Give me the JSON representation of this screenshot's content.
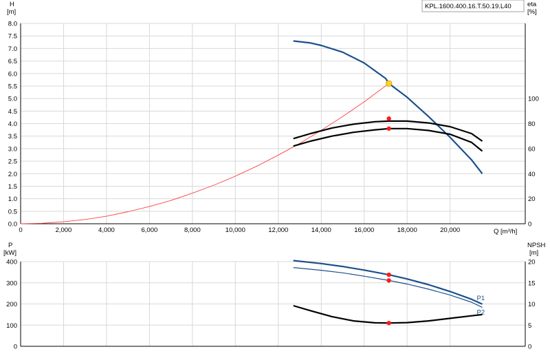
{
  "pump_id": "KPL.1600.400.16.T.50.19.L40",
  "top_axes": {
    "y_left_label": "H",
    "y_left_unit": "[m]",
    "y_right_label": "eta",
    "y_right_unit": "[%]",
    "x_label": "Q [m³/h]",
    "x_ticks": [
      "0",
      "2,000",
      "4,000",
      "6,000",
      "8,000",
      "10,000",
      "12,000",
      "14,000",
      "16,000",
      "18,000",
      "20,000"
    ],
    "y_left_ticks": [
      "0.0",
      "0.5",
      "1.0",
      "1.5",
      "2.0",
      "2.5",
      "3.0",
      "3.5",
      "4.0",
      "4.5",
      "5.0",
      "5.5",
      "6.0",
      "6.5",
      "7.0",
      "7.5",
      "8.0"
    ],
    "y_right_ticks": [
      "0",
      "20",
      "40",
      "60",
      "80",
      "100"
    ]
  },
  "bottom_axes": {
    "y_left_label": "P",
    "y_left_unit": "[kW]",
    "y_right_label": "NPSH",
    "y_right_unit": "[m]",
    "y_left_ticks": [
      "0",
      "100",
      "200",
      "300",
      "400"
    ],
    "y_right_ticks": [
      "0",
      "5",
      "10",
      "15",
      "20"
    ]
  },
  "chart_data": [
    {
      "type": "line",
      "panel": "head-efficiency",
      "xlabel": "Q [m³/h]",
      "ylabel": "H [m]",
      "y2label": "eta [%]",
      "xlim": [
        0,
        23500
      ],
      "ylim": [
        0,
        8.0
      ],
      "y2lim": [
        0,
        160
      ],
      "grid": true,
      "series": [
        {
          "name": "",
          "axis": "left",
          "color": "#1a4f8c",
          "x": [
            12700,
            13500,
            14000,
            15000,
            16000,
            17000,
            17150,
            18000,
            19000,
            20000,
            21000,
            21500
          ],
          "y": [
            7.3,
            7.22,
            7.12,
            6.85,
            6.42,
            5.8,
            5.6,
            5.05,
            4.28,
            3.45,
            2.55,
            2.0
          ]
        },
        {
          "name": "",
          "axis": "left",
          "color": "#ff4040",
          "x": [
            0,
            1000,
            2000,
            3000,
            4000,
            5000,
            6000,
            7000,
            8000,
            9000,
            10000,
            11000,
            12000,
            13000,
            14000,
            15000,
            16000,
            17150
          ],
          "y": [
            0,
            0.02,
            0.08,
            0.17,
            0.3,
            0.48,
            0.69,
            0.93,
            1.22,
            1.54,
            1.9,
            2.3,
            2.74,
            3.21,
            3.73,
            4.28,
            4.87,
            5.6
          ]
        },
        {
          "name": "",
          "axis": "right",
          "color": "#000000",
          "x": [
            12700,
            13500,
            14500,
            15500,
            16500,
            17150,
            18000,
            19000,
            20000,
            21000,
            21500
          ],
          "y": [
            68,
            72,
            76.5,
            79.5,
            81.5,
            82.0,
            82.0,
            80.5,
            77.5,
            72.0,
            66.0
          ]
        },
        {
          "name": "",
          "axis": "right",
          "color": "#000000",
          "x": [
            12700,
            13500,
            14500,
            15500,
            16500,
            17150,
            18000,
            19000,
            20000,
            21000,
            21500
          ],
          "y": [
            62,
            66,
            70,
            73,
            75,
            76.0,
            76.0,
            74.5,
            71.5,
            65.0,
            58.0
          ]
        }
      ],
      "markers": [
        {
          "series_axis": "left",
          "x": 17150,
          "y": 5.6,
          "color": "#ffd21e"
        },
        {
          "series_axis": "right",
          "x": 17150,
          "y": 84.0,
          "color": "#ff1a1a"
        },
        {
          "series_axis": "right",
          "x": 17150,
          "y": 76.0,
          "color": "#ff1a1a"
        }
      ]
    },
    {
      "type": "line",
      "panel": "power-npsh",
      "xlabel": "Q [m³/h]",
      "ylabel": "P [kW]",
      "y2label": "NPSH [m]",
      "xlim": [
        0,
        23500
      ],
      "ylim": [
        0,
        400
      ],
      "y2lim": [
        0,
        20
      ],
      "grid": true,
      "series": [
        {
          "name": "P1",
          "axis": "left",
          "color": "#1a4f8c",
          "x": [
            12700,
            14000,
            15000,
            16000,
            17150,
            18000,
            19000,
            20000,
            21000,
            21500
          ],
          "y": [
            405,
            391,
            377,
            360,
            338,
            318,
            291,
            259,
            222,
            199
          ]
        },
        {
          "name": "P2",
          "axis": "left",
          "color": "#1a4f8c",
          "x": [
            12700,
            14000,
            15000,
            16000,
            17150,
            18000,
            19000,
            20000,
            21000,
            21500
          ],
          "y": [
            372,
            359,
            347,
            331,
            311,
            294,
            270,
            242,
            208,
            184
          ]
        },
        {
          "name": "",
          "axis": "right",
          "color": "#000000",
          "x": [
            12700,
            13500,
            14500,
            15500,
            16500,
            17150,
            18000,
            19000,
            20000,
            21000,
            21500
          ],
          "y": [
            9.6,
            8.4,
            7.0,
            6.0,
            5.55,
            5.5,
            5.6,
            6.0,
            6.6,
            7.2,
            7.5
          ]
        }
      ],
      "markers": [
        {
          "series_axis": "left",
          "x": 17150,
          "y": 338,
          "color": "#ff1a1a"
        },
        {
          "series_axis": "left",
          "x": 17150,
          "y": 311,
          "color": "#ff1a1a"
        },
        {
          "series_axis": "right",
          "x": 17150,
          "y": 5.5,
          "color": "#ff1a1a"
        }
      ]
    }
  ]
}
